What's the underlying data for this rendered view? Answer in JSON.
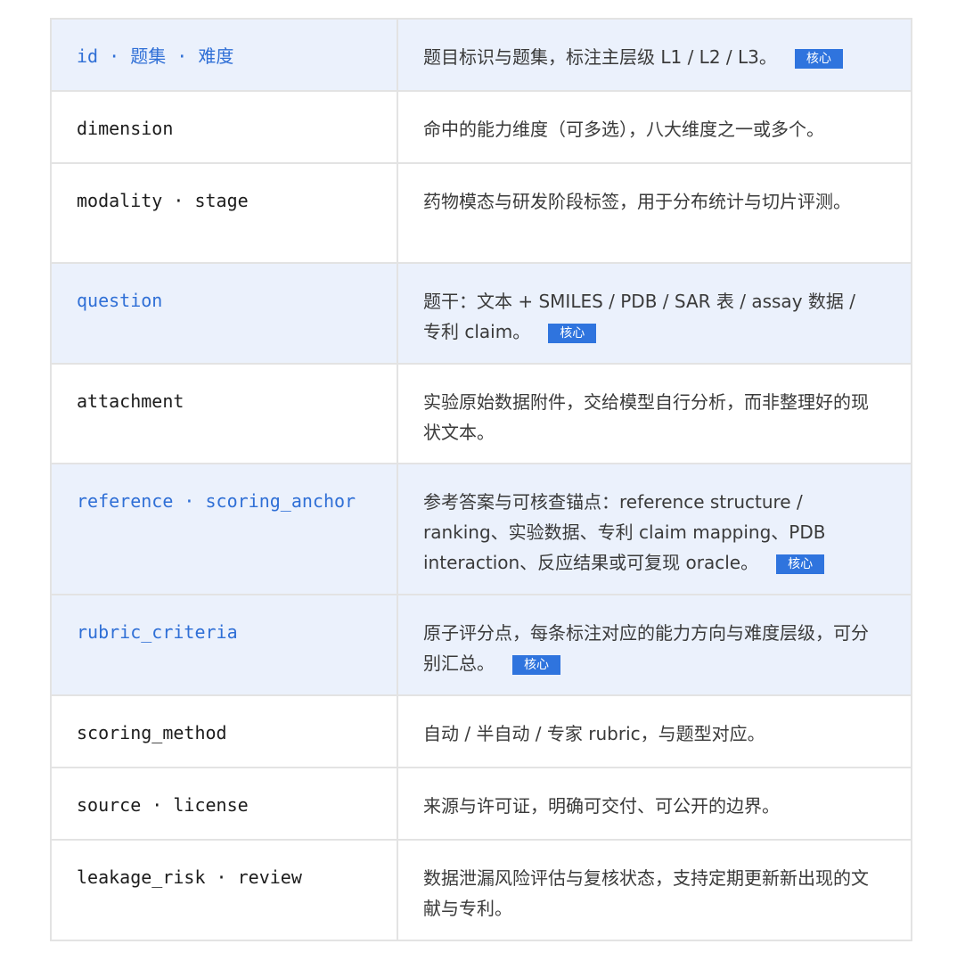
{
  "badge_label": "核心",
  "rows": [
    {
      "field": "id · 题集 · 难度",
      "desc": "题目标识与题集，标注主层级 L1 / L2 / L3。",
      "core": true
    },
    {
      "field": "dimension",
      "desc": "命中的能力维度（可多选），八大维度之一或多个。",
      "core": false
    },
    {
      "field": "modality · stage",
      "desc": "药物模态与研发阶段标签，用于分布统计与切片评测。",
      "core": false
    },
    {
      "field": "question",
      "desc": "题干：文本 + SMILES / PDB / SAR 表 / assay 数据 / 专利 claim。",
      "core": true
    },
    {
      "field": "attachment",
      "desc": "实验原始数据附件，交给模型自行分析，而非整理好的现状文本。",
      "core": false
    },
    {
      "field": "reference · scoring_anchor",
      "desc": "参考答案与可核查锚点：reference structure / ranking、实验数据、专利 claim mapping、PDB interaction、反应结果或可复现 oracle。",
      "core": true
    },
    {
      "field": "rubric_criteria",
      "desc": "原子评分点，每条标注对应的能力方向与难度层级，可分别汇总。",
      "core": true
    },
    {
      "field": "scoring_method",
      "desc": "自动 / 半自动 / 专家 rubric，与题型对应。",
      "core": false
    },
    {
      "field": "source · license",
      "desc": "来源与许可证，明确可交付、可公开的边界。",
      "core": false
    },
    {
      "field": "leakage_risk · review",
      "desc": "数据泄漏风险评估与复核状态，支持定期更新新出现的文献与专利。",
      "core": false
    }
  ],
  "colors": {
    "highlight_row": "#ebf1fc",
    "core_field_text": "#2f6fd6",
    "badge_bg": "#2f74de",
    "border": "#e3e3e3"
  }
}
